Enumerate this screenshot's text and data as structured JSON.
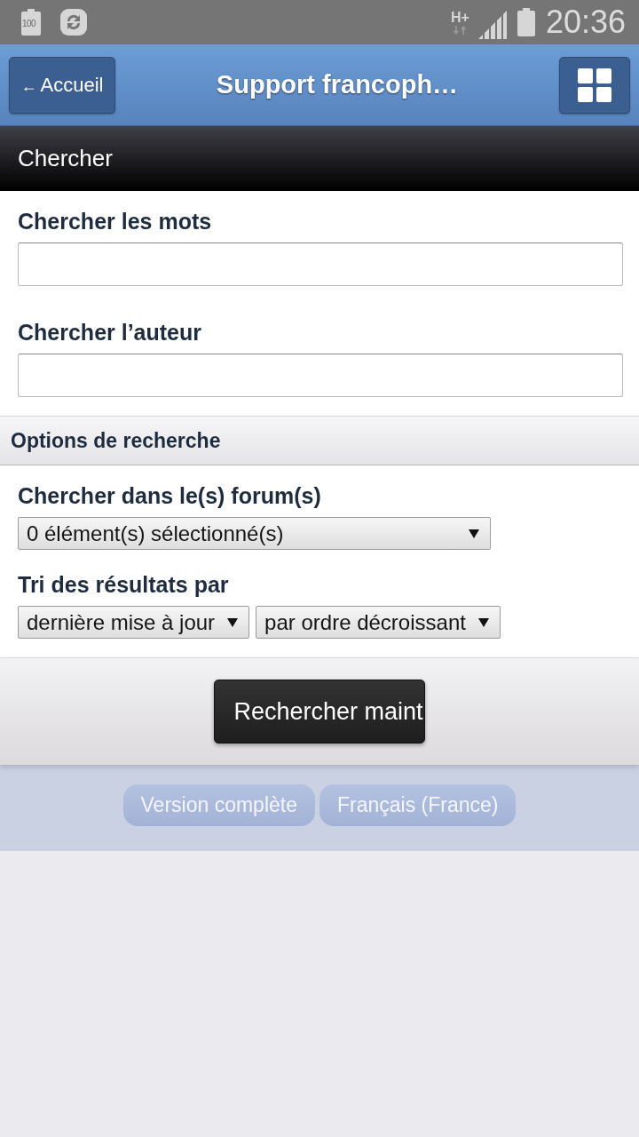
{
  "status_bar": {
    "battery_notification": "100",
    "network_type": "H+",
    "time": "20:36"
  },
  "header": {
    "back_button": {
      "arrow": "←",
      "label": "Accueil"
    },
    "title": "Support francoph…"
  },
  "page_title": "Chercher",
  "fields": [
    {
      "label": "Chercher les mots"
    },
    {
      "label": "Chercher l’auteur"
    }
  ],
  "options": {
    "title": "Options de recherche",
    "groups": [
      {
        "label": "Chercher dans le(s) forum(s)",
        "selects": [
          "0 élément(s) sélectionné(s)"
        ]
      },
      {
        "label": "Tri des résultats par",
        "selects": [
          "dernière mise à jour",
          "par ordre décroissant"
        ]
      }
    ]
  },
  "submit_button": "Rechercher maint",
  "footer_links": [
    "Version complète",
    "Français (France)"
  ]
}
